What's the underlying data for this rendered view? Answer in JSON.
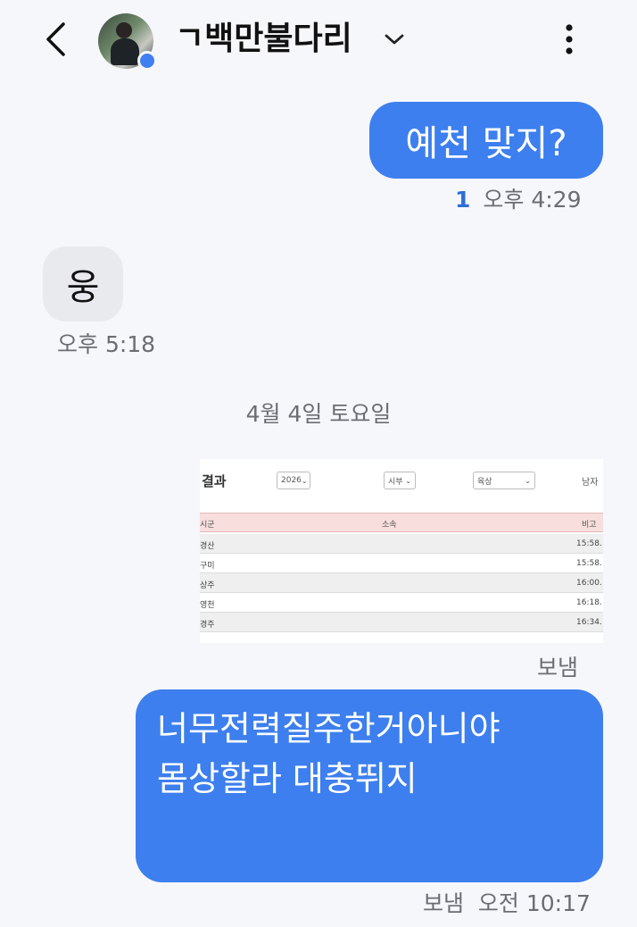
{
  "header": {
    "contact_name": "ㄱ백만불다리",
    "icons": {
      "back": "chevron-left-icon",
      "dropdown": "chevron-down-icon",
      "more": "more-vertical-icon"
    },
    "online_dot_color": "#3f7ff0"
  },
  "messages": [
    {
      "direction": "sent",
      "text": "예천 맞지?",
      "read_count": "1",
      "time": "오후 4:29"
    },
    {
      "direction": "received",
      "text": "웅",
      "time": "오후 5:18"
    },
    {
      "type": "date_separator",
      "text": "4월 4일 토요일"
    },
    {
      "direction": "sent",
      "type": "image",
      "status": "보냄",
      "image": {
        "title": "결과",
        "selects": [
          "2026",
          "시부",
          "육상"
        ],
        "cut_label": "남자",
        "table_headers": [
          "시군",
          "소속",
          "비고"
        ],
        "rows": [
          [
            "경산",
            "15:58."
          ],
          [
            "구미",
            "15:58."
          ],
          [
            "상주",
            "16:00."
          ],
          [
            "영천",
            "16:18."
          ],
          [
            "경주",
            "16:34."
          ]
        ]
      }
    },
    {
      "direction": "sent",
      "lines": [
        "너무전력질주한거아니야",
        "몸상할라 대충뛰지"
      ],
      "status": "보냄",
      "time": "오전 10:17"
    }
  ],
  "colors": {
    "sent_bubble": "#3d7fee",
    "received_bubble": "#e9eaee",
    "background": "#f6f7fb",
    "read_count": "#2c6fd8"
  }
}
